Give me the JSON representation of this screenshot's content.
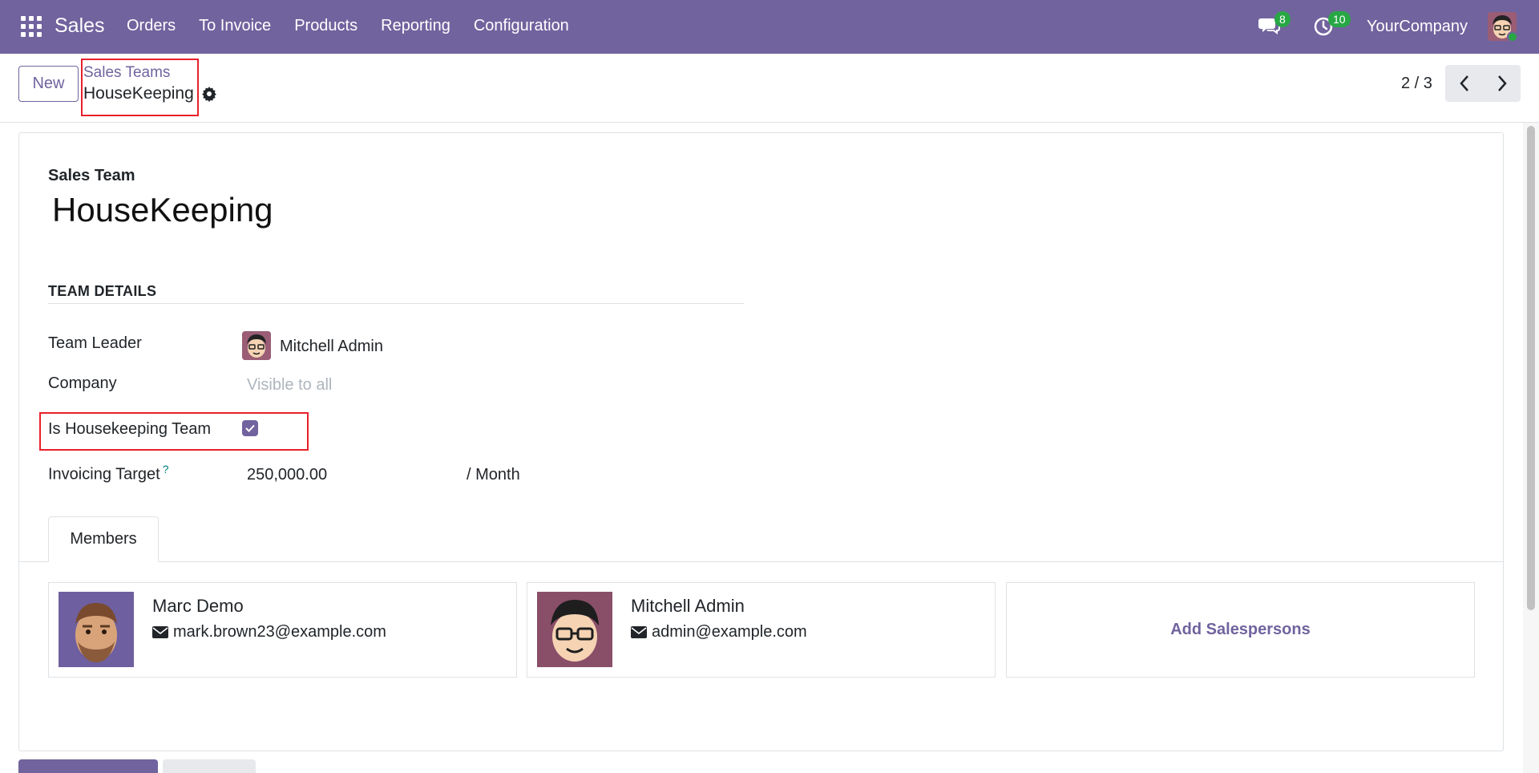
{
  "navbar": {
    "brand": "Sales",
    "menu": [
      "Orders",
      "To Invoice",
      "Products",
      "Reporting",
      "Configuration"
    ],
    "messages_badge": "8",
    "activities_badge": "10",
    "company": "YourCompany",
    "color": "#71639e"
  },
  "control_panel": {
    "new_label": "New",
    "breadcrumb_parent": "Sales Teams",
    "breadcrumb_current": "HouseKeeping",
    "pager": "2 / 3"
  },
  "form": {
    "title_label": "Sales Team",
    "title": "HouseKeeping",
    "section": "TEAM DETAILS",
    "team_leader_label": "Team Leader",
    "team_leader": "Mitchell Admin",
    "company_label": "Company",
    "company_placeholder": "Visible to all",
    "housekeeping_label": "Is Housekeeping Team",
    "housekeeping_checked": true,
    "invoicing_label": "Invoicing Target",
    "invoicing_help": "?",
    "invoicing_value": "250,000.00",
    "invoicing_unit": "/ Month"
  },
  "tabs": [
    "Members"
  ],
  "members": [
    {
      "name": "Marc Demo",
      "email": "mark.brown23@example.com"
    },
    {
      "name": "Mitchell Admin",
      "email": "admin@example.com"
    }
  ],
  "add_salespersons": "Add Salespersons",
  "colors": {
    "primary": "#71639e",
    "highlight": "#e8202a",
    "badge": "#28a745"
  }
}
